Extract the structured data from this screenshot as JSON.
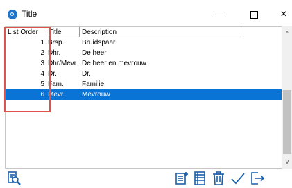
{
  "window": {
    "title": "Title",
    "minimize_label": "",
    "maximize_label": "",
    "close_label": "×"
  },
  "grid": {
    "headers": {
      "list_order": "List Order",
      "title": "Title",
      "description": "Description"
    },
    "rows": [
      {
        "order": "1",
        "title": "Brsp.",
        "description": "Bruidspaar"
      },
      {
        "order": "2",
        "title": "Dhr.",
        "description": "De heer"
      },
      {
        "order": "3",
        "title": "Dhr/Mevr",
        "description": "De heer en mevrouw"
      },
      {
        "order": "4",
        "title": "Dr.",
        "description": "Dr."
      },
      {
        "order": "5",
        "title": "Fam.",
        "description": "Familie"
      },
      {
        "order": "6",
        "title": "Mevr.",
        "description": "Mevrouw"
      }
    ],
    "selected_row": 6
  },
  "scrollbar": {
    "up_arrow": "^",
    "down_arrow": "v"
  },
  "toolbar": {
    "buttons": [
      "search-report-icon",
      "add-item-icon",
      "list-view-icon",
      "delete-icon",
      "confirm-check-icon",
      "exit-icon"
    ]
  },
  "colors": {
    "selection": "#0a73d6",
    "highlight_box": "#e0524d",
    "icon_blue": "#1b5fa8"
  }
}
